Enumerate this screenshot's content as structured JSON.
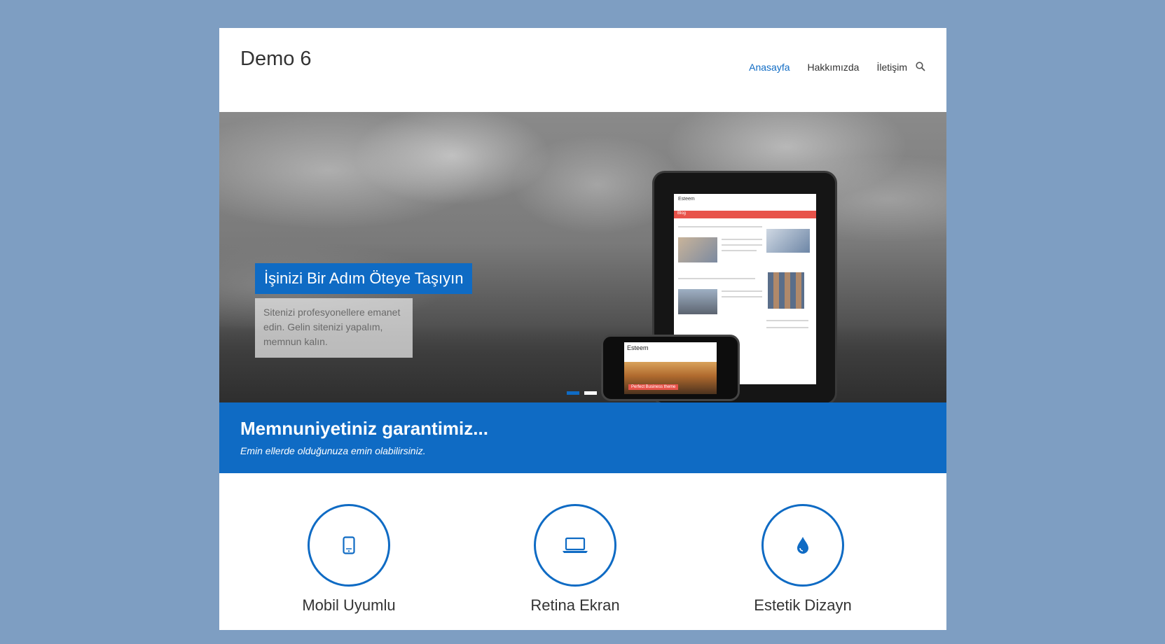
{
  "header": {
    "site_title": "Demo 6",
    "nav": [
      "Anasayfa",
      "Hakkımızda",
      "İletişim"
    ]
  },
  "slider": {
    "title": "İşinizi Bir Adım Öteye Taşıyın",
    "description": "Sitenizi profesyonellere emanet edin. Gelin sitenizi yapalım, memnun kalın.",
    "tablet_screen": {
      "title": "Esteem",
      "bar_label": "Blog"
    },
    "phone_screen": {
      "title": "Esteem",
      "badge": "Perfect Business theme"
    },
    "active_slide": 1
  },
  "banner": {
    "title": "Memnuniyetiniz garantimiz...",
    "subtitle": "Emin ellerde olduğunuza emin olabilirsiniz."
  },
  "features": [
    {
      "icon": "mobile-icon",
      "title": "Mobil Uyumlu"
    },
    {
      "icon": "laptop-icon",
      "title": "Retina Ekran"
    },
    {
      "icon": "drop-icon",
      "title": "Estetik Dizayn"
    }
  ],
  "colors": {
    "accent": "#0f6bc4",
    "background": "#7e9ec2"
  }
}
